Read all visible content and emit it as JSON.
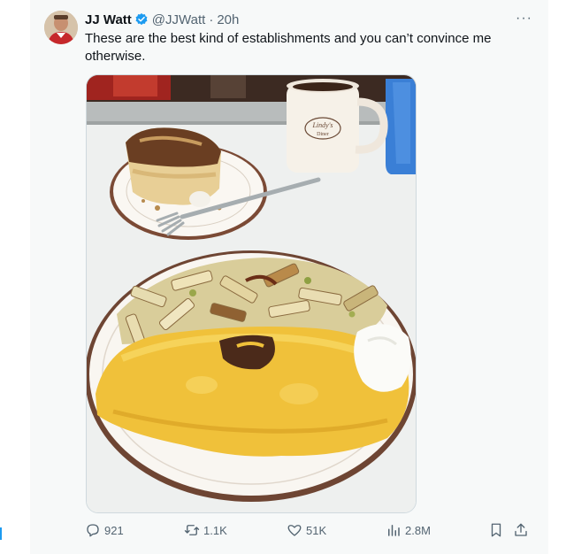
{
  "tweet": {
    "author_name": "JJ Watt",
    "handle": "@JJWatt",
    "separator": "·",
    "time": "20h",
    "text": "These are the best kind of establishments and you can’t convince me otherwise.",
    "more_label": "···",
    "mug_text": [
      "Lindy's",
      "Diner"
    ]
  },
  "actions": {
    "replies": "921",
    "retweets": "1.1K",
    "likes": "51K",
    "views": "2.8M"
  },
  "icons": {
    "verified": "verified-badge-icon",
    "reply": "reply-icon",
    "retweet": "retweet-icon",
    "like": "heart-icon",
    "views": "views-chart-icon",
    "bookmark": "bookmark-icon",
    "share": "share-icon"
  },
  "colors": {
    "accent": "#1d9bf0",
    "muted": "#536471",
    "text": "#0f1419"
  }
}
